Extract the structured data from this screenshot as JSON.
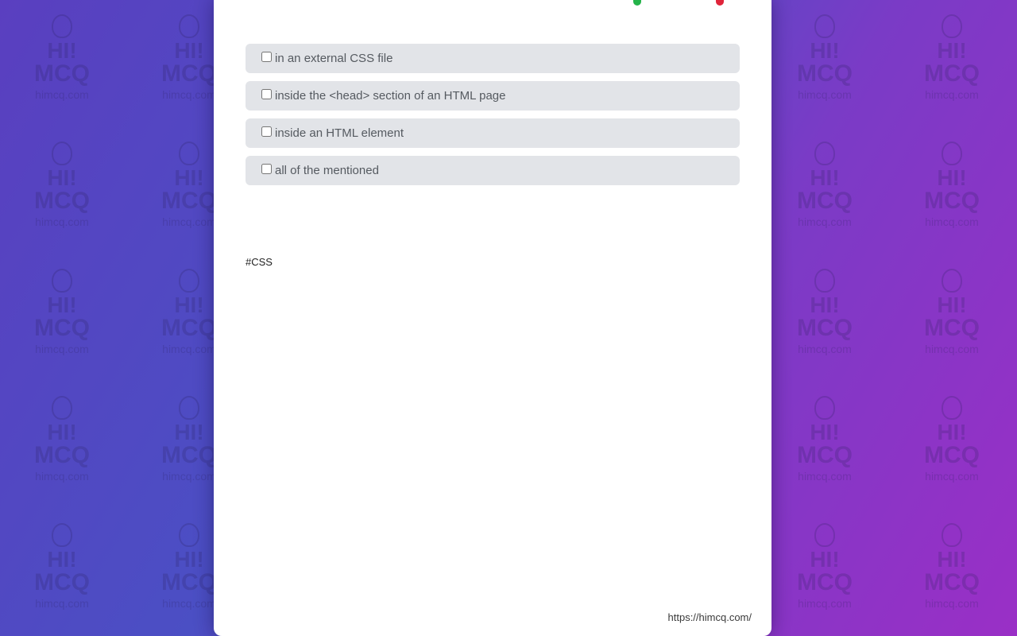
{
  "background": {
    "watermark": {
      "hi": "HI!",
      "mcq": "MCQ",
      "url": "himcq.com"
    },
    "gradient_colors": [
      "#5a3fc0",
      "#4b4fc4",
      "#7a3bc6",
      "#9a2fc6"
    ]
  },
  "top_icons": [
    {
      "icon": "whatsapp-icon",
      "color": "#25b34a"
    },
    {
      "icon": "pinterest-icon",
      "color": "#e0243a"
    }
  ],
  "options": [
    {
      "label": "in an external CSS file",
      "checked": false
    },
    {
      "label": "inside the <head> section of an HTML page",
      "checked": false
    },
    {
      "label": "inside an HTML element",
      "checked": false
    },
    {
      "label": "all of the mentioned",
      "checked": false
    }
  ],
  "tag": "#CSS",
  "footer_url": "https://himcq.com/"
}
